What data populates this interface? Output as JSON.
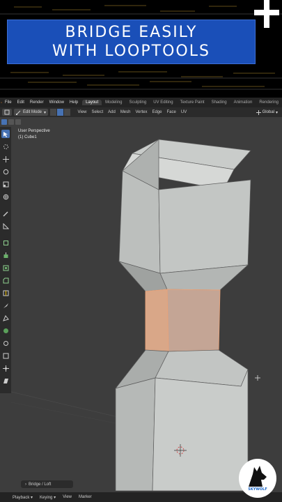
{
  "banner": {
    "line1": "BRIDGE EASILY",
    "line2": "WITH LOOPTOOLS",
    "bg_color": "#1a4fb8"
  },
  "menubar": {
    "items": [
      "File",
      "Edit",
      "Render",
      "Window",
      "Help"
    ],
    "workspace_tabs": [
      "Layout",
      "Modeling",
      "Sculpting",
      "UV Editing",
      "Texture Paint",
      "Shading",
      "Animation",
      "Rendering"
    ],
    "active_tab": "Layout"
  },
  "header": {
    "mode": "Edit Mode",
    "menus": [
      "View",
      "Select",
      "Add",
      "Mesh",
      "Vertex",
      "Edge",
      "Face",
      "UV"
    ],
    "orientation": "Global"
  },
  "viewport": {
    "perspective_label": "User Perspective",
    "object_label": "(1) Cube1",
    "selection_color": "#e8a37a"
  },
  "operator_panel": {
    "label": "Bridge / Loft"
  },
  "timeline": {
    "items": [
      "Playback",
      "Keying",
      "View",
      "Marker"
    ]
  },
  "toolbar": {
    "tools": [
      "select-box-icon",
      "cursor-icon",
      "move-icon",
      "rotate-icon",
      "scale-icon",
      "transform-icon",
      "annotate-icon",
      "measure-icon",
      "add-cube-icon",
      "extrude-icon",
      "inset-icon",
      "bevel-icon",
      "loop-cut-icon",
      "knife-icon",
      "poly-build-icon",
      "spin-icon",
      "smooth-icon",
      "edge-slide-icon",
      "shrink-fatten-icon",
      "shear-icon",
      "rip-icon"
    ]
  },
  "watermark": {
    "text": "SKYWOLF"
  }
}
